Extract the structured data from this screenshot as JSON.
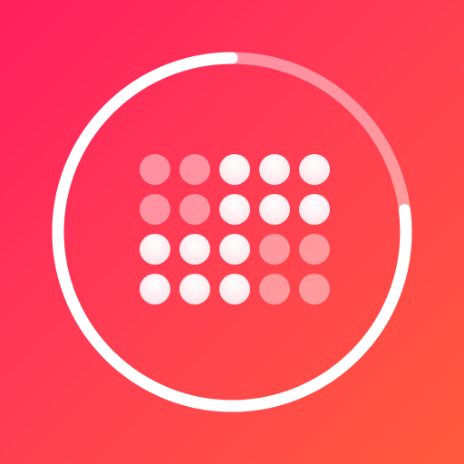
{
  "icon": {
    "semantic": "calendar-progress-icon",
    "colors": {
      "gradient_start": "#ff1f5f",
      "gradient_mid": "#ff3f52",
      "gradient_end": "#ff5a3c",
      "ring_filled": "#ffffff",
      "ring_track": "rgba(255,255,255,0.45)",
      "dot_bright": "#ffffff",
      "dot_dim": "rgba(255,255,255,0.45)"
    },
    "progress_ring_fraction": 0.77,
    "dot_grid": {
      "rows": 4,
      "cols": 5,
      "states": [
        [
          0,
          0,
          1,
          1,
          1
        ],
        [
          0,
          0,
          1,
          1,
          1
        ],
        [
          1,
          1,
          1,
          0,
          0
        ],
        [
          1,
          1,
          1,
          0,
          0
        ]
      ]
    }
  }
}
